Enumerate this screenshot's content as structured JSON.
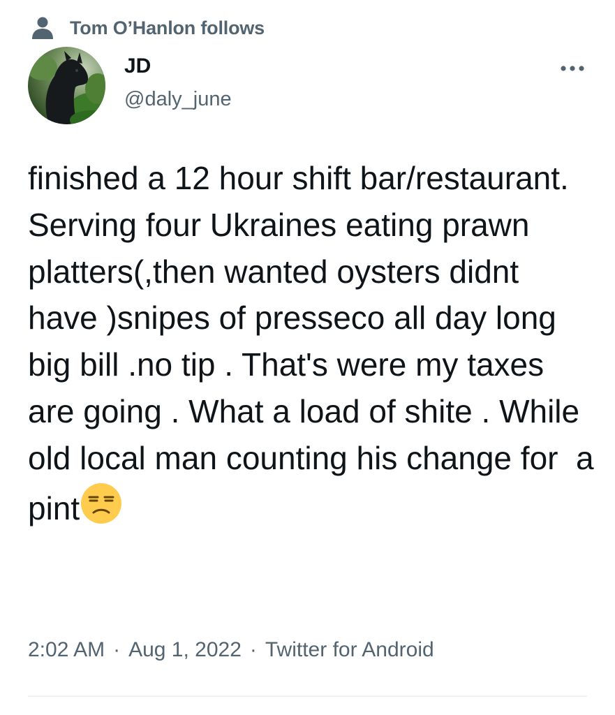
{
  "social_context": {
    "icon": "person-icon",
    "text": "Tom O’Hanlon follows"
  },
  "author": {
    "display_name": "JD",
    "handle": "@daly_june",
    "avatar": "avatar-image"
  },
  "more_icon": "more-icon",
  "tweet": {
    "text": "finished a 12 hour shift bar/restaurant. Serving four Ukraines eating prawn platters(,then wanted oysters didnt have )snipes of presseco all day long big bill .no tip . That's were my taxes are going . What a load of shite . While old local man counting his change for  a pint",
    "emoji": "unamused-face-emoji"
  },
  "meta": {
    "time": "2:02 AM",
    "separator": "·",
    "date": "Aug 1, 2022",
    "source": "Twitter for Android"
  },
  "colors": {
    "primary_text": "#0f1419",
    "secondary_text": "#536471",
    "divider": "#eff3f4"
  }
}
